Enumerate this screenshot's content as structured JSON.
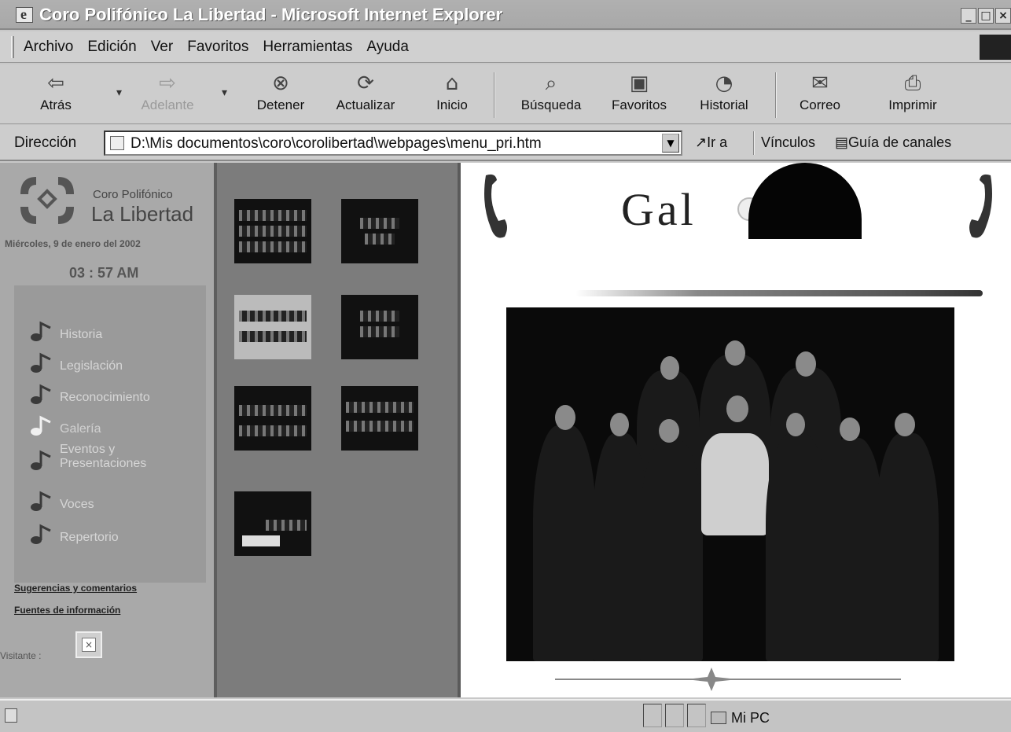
{
  "window": {
    "title": "Coro Polifónico La Libertad - Microsoft Internet Explorer"
  },
  "menubar": [
    "Archivo",
    "Edición",
    "Ver",
    "Favoritos",
    "Herramientas",
    "Ayuda"
  ],
  "toolbar": {
    "back": "Atrás",
    "forward": "Adelante",
    "stop": "Detener",
    "refresh": "Actualizar",
    "home": "Inicio",
    "search": "Búsqueda",
    "favorites": "Favoritos",
    "history": "Historial",
    "mail": "Correo",
    "print": "Imprimir"
  },
  "address": {
    "label": "Dirección",
    "url": "D:\\Mis documentos\\coro\\corolibertad\\webpages\\menu_pri.htm",
    "go": "Ir a",
    "links_label": "Vínculos",
    "links_item": "Guía de canales"
  },
  "site": {
    "logo_line1": "Coro Polifónico",
    "logo_line2": "La Libertad",
    "date": "Miércoles, 9 de enero del 2002",
    "time": "03 : 57 AM",
    "nav": [
      {
        "label": "Historia"
      },
      {
        "label": "Legislación"
      },
      {
        "label": "Reconocimiento"
      },
      {
        "label": "Galería"
      },
      {
        "label": "Eventos y Presentaciones"
      },
      {
        "label": "Voces"
      },
      {
        "label": "Repertorio"
      }
    ],
    "active_nav": "Galería",
    "links": {
      "suggestions": "Sugerencias y comentarios",
      "sources": "Fuentes de información"
    },
    "visits_label": "Visitante :",
    "gallery_heading": "Gal"
  },
  "statusbar": {
    "zone": "Mi PC"
  },
  "colors": {
    "nav_panel": "#a9a9a9",
    "thumb_panel": "#7c7c7c",
    "content_bg": "#ffffff",
    "titlebar_text": "#ffffff"
  }
}
